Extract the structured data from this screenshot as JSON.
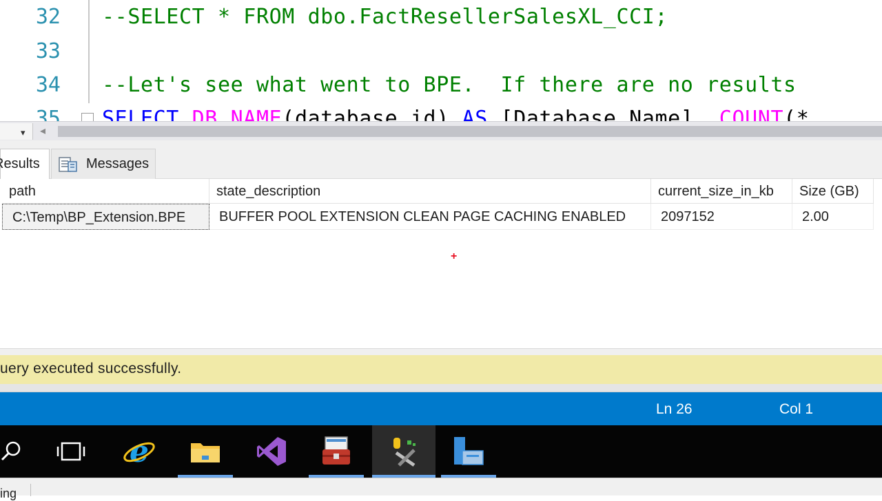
{
  "editor": {
    "lines": [
      {
        "number": "32",
        "code": "--SELECT * FROM dbo.FactResellerSalesXL_CCI;"
      },
      {
        "number": "33",
        "code": ""
      },
      {
        "number": "34",
        "code": "--Let's see what went to BPE.  If there are no results"
      },
      {
        "number": "35",
        "code_parts": [
          "SELECT",
          " DB_NAME",
          "(database_id) ",
          "AS",
          " [Database Name], ",
          "COUNT",
          "(*"
        ]
      }
    ]
  },
  "scrollbar": {
    "zoom_arrow": "▾",
    "left_arrow": "◂"
  },
  "tabs": {
    "results_label": "Results",
    "messages_label": "Messages"
  },
  "grid": {
    "columns": [
      "path",
      "state_description",
      "current_size_in_kb",
      "Size (GB)"
    ],
    "rows": [
      [
        "C:\\Temp\\BP_Extension.BPE",
        "BUFFER POOL EXTENSION CLEAN PAGE CACHING ENABLED",
        "2097152",
        "2.00"
      ]
    ]
  },
  "query_status": {
    "text": "uery executed successfully."
  },
  "statusbar": {
    "line": "Ln 26",
    "col": "Col 1"
  },
  "taskbar": {
    "items": [
      "search",
      "task-view",
      "internet-explorer",
      "file-explorer",
      "visual-studio",
      "toolbox",
      "sql-tools",
      "server-manager"
    ],
    "active_item": "sql-tools"
  },
  "bottom": {
    "text": "ing"
  },
  "colors": {
    "comment": "#008000",
    "keyword": "#0000ff",
    "function": "#ff00ff",
    "line_number": "#2b91af",
    "status_bar": "#007acc",
    "query_bar": "#f1eaa8"
  }
}
